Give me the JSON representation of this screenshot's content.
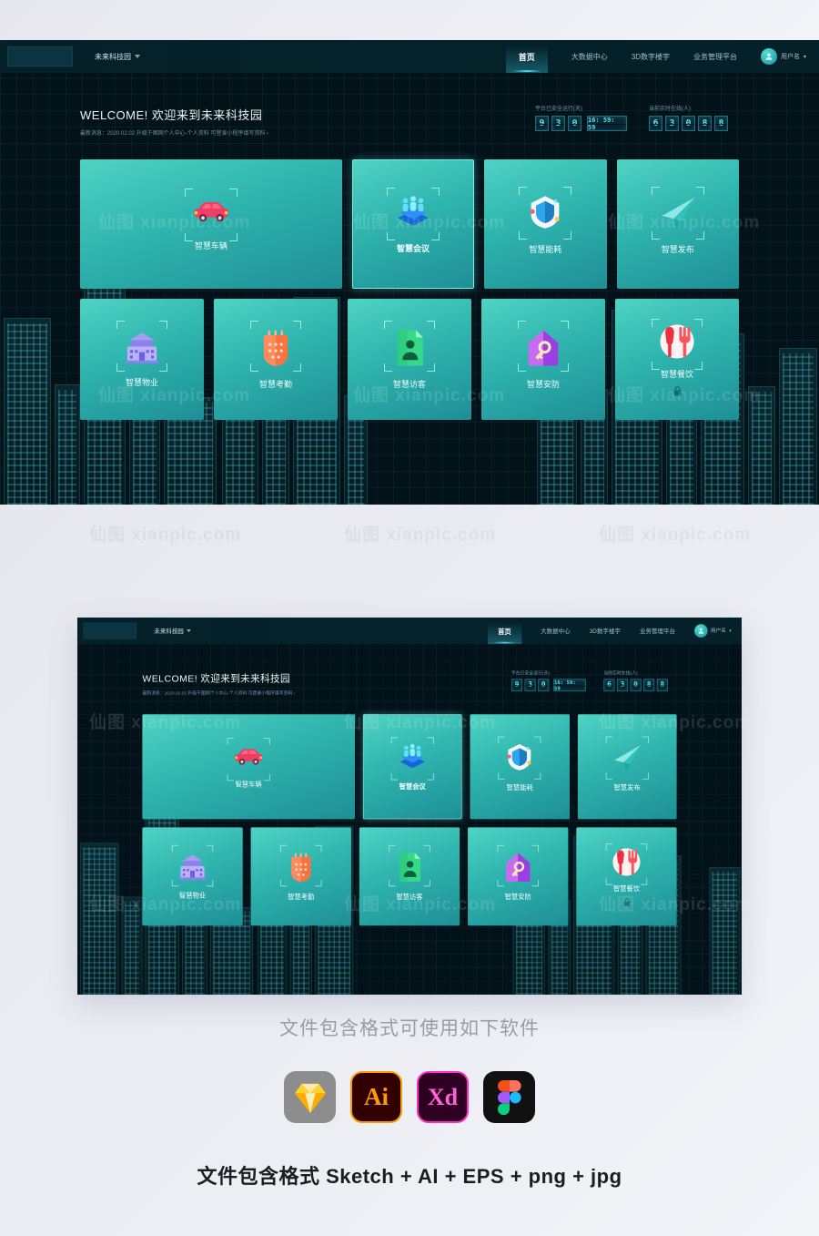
{
  "header": {
    "logo_placeholder": "",
    "brand": "未来科技园",
    "nav": [
      {
        "label": "首页",
        "active": true
      },
      {
        "label": "大数据中心",
        "active": false
      },
      {
        "label": "3D数字楼宇",
        "active": false
      },
      {
        "label": "业务管理平台",
        "active": false
      }
    ],
    "user_name": "用户名",
    "user_caret": "▾"
  },
  "welcome": {
    "title": "WELCOME! 欢迎来到未来科技园",
    "news": "最新消息：2020.02.02 升级千图网个人中心-个人资料 可登录小程序填写资料  ›"
  },
  "counters": [
    {
      "label": "平台已安全运行(天)",
      "digits": [
        "9",
        "3",
        "0"
      ],
      "clock": "16: 59: 59"
    },
    {
      "label": "当前实时在线(人)",
      "digits": [
        "6",
        "3",
        "0",
        "8",
        "8"
      ],
      "clock": ""
    }
  ],
  "cards": {
    "row1": [
      {
        "label": "智慧车辆",
        "icon": "car-icon",
        "wide": true,
        "selected": false,
        "locked": false
      },
      {
        "label": "智慧会议",
        "icon": "meeting-icon",
        "wide": false,
        "selected": true,
        "locked": false
      },
      {
        "label": "智慧能耗",
        "icon": "energy-shield-icon",
        "wide": false,
        "selected": false,
        "locked": false
      },
      {
        "label": "智慧发布",
        "icon": "paper-plane-icon",
        "wide": false,
        "selected": false,
        "locked": false
      }
    ],
    "row2": [
      {
        "label": "智慧物业",
        "icon": "building-icon",
        "wide": false,
        "selected": false,
        "locked": false
      },
      {
        "label": "智慧考勤",
        "icon": "calendar-icon",
        "wide": false,
        "selected": false,
        "locked": false
      },
      {
        "label": "智慧访客",
        "icon": "visitor-badge-icon",
        "wide": false,
        "selected": false,
        "locked": false
      },
      {
        "label": "智慧安防",
        "icon": "security-key-icon",
        "wide": false,
        "selected": false,
        "locked": false
      },
      {
        "label": "智慧餐饮",
        "icon": "dining-icon",
        "wide": false,
        "selected": false,
        "locked": true
      }
    ]
  },
  "footer": {
    "heading": "文件包含格式可使用如下软件",
    "apps": [
      {
        "name": "sketch-icon",
        "label": ""
      },
      {
        "name": "illustrator-icon",
        "label": "Ai"
      },
      {
        "name": "xd-icon",
        "label": "Xd"
      },
      {
        "name": "figma-icon",
        "label": ""
      }
    ],
    "formats": "文件包含格式 Sketch + AI + EPS + png + jpg"
  },
  "watermark": {
    "text": "仙图 xianpic.com"
  },
  "colors": {
    "bg_dark": "#031219",
    "card_teal": "#2fb4ae",
    "accent_cyan": "#49d8e6",
    "digit_cyan": "#56e3f0",
    "page_bg": "#eceef4"
  }
}
